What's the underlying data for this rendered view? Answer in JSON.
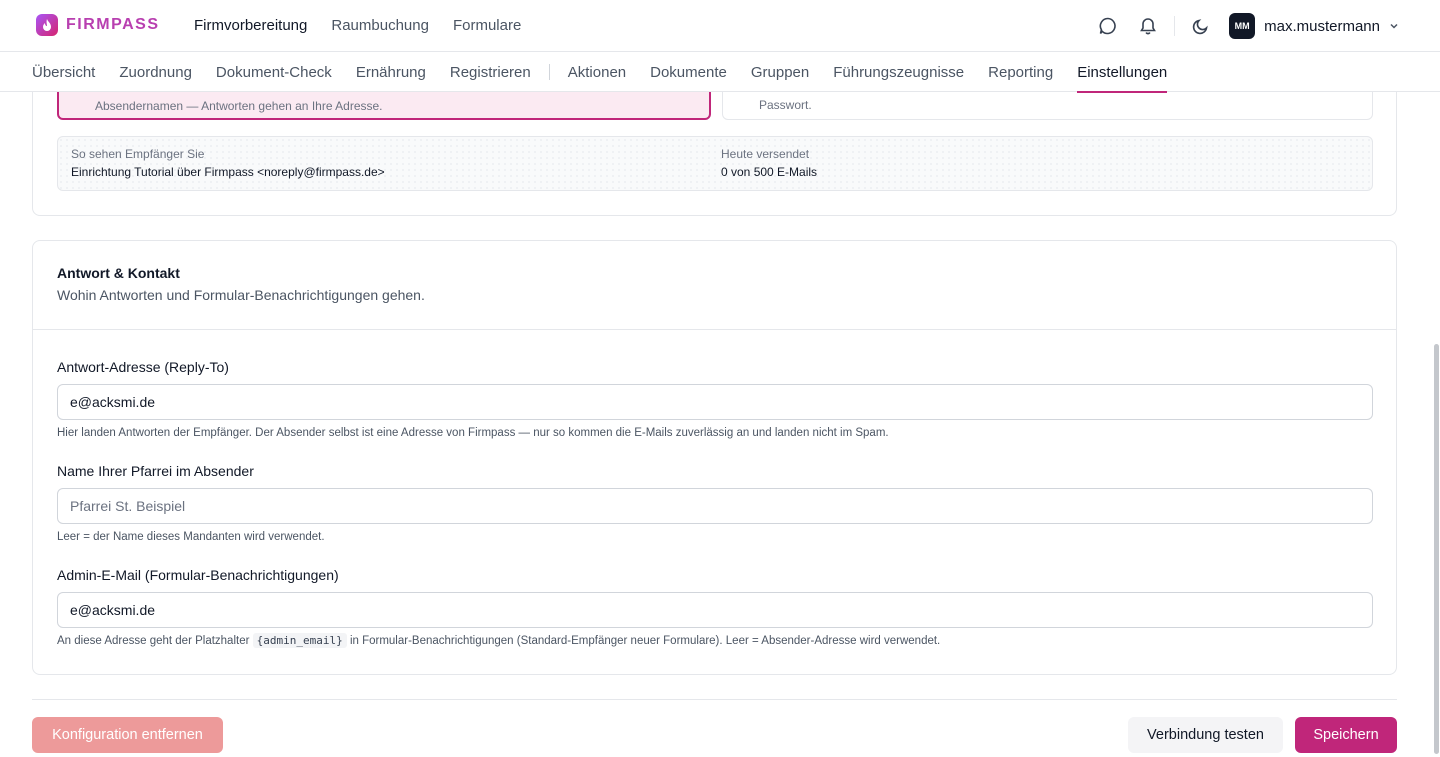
{
  "brand": {
    "name": "FIRMPASS"
  },
  "mainnav": [
    "Firmvorbereitung",
    "Raumbuchung",
    "Formulare"
  ],
  "user": {
    "initials": "MM",
    "name": "max.mustermann"
  },
  "subnav": {
    "group1": [
      "Übersicht",
      "Zuordnung",
      "Dokument-Check",
      "Ernährung",
      "Registrieren"
    ],
    "group2": [
      "Aktionen",
      "Dokumente",
      "Gruppen",
      "Führungszeugnisse",
      "Reporting",
      "Einstellungen"
    ],
    "active": "Einstellungen"
  },
  "sender_card": {
    "option_left_text": "Absendernamen — Antworten gehen an Ihre Adresse.",
    "option_right_text": "Passwort.",
    "preview_label": "So sehen Empfänger Sie",
    "preview_value": "Einrichtung Tutorial über Firmpass <noreply@firmpass.de>",
    "sent_label": "Heute versendet",
    "sent_value": "0 von 500 E-Mails"
  },
  "reply_card": {
    "title": "Antwort & Kontakt",
    "subtitle": "Wohin Antworten und Formular-Benachrichtigungen gehen.",
    "reply_to": {
      "label": "Antwort-Adresse (Reply-To)",
      "value": "e@acksmi.de",
      "help": "Hier landen Antworten der Empfänger. Der Absender selbst ist eine Adresse von Firmpass — nur so kommen die E-Mails zuverlässig an und landen nicht im Spam."
    },
    "sender_name": {
      "label": "Name Ihrer Pfarrei im Absender",
      "value": "",
      "placeholder": "Pfarrei St. Beispiel",
      "help": "Leer = der Name dieses Mandanten wird verwendet."
    },
    "admin_email": {
      "label": "Admin-E-Mail (Formular-Benachrichtigungen)",
      "value": "e@acksmi.de",
      "help_before": "An diese Adresse geht der Platzhalter",
      "help_code": "{admin_email}",
      "help_after": "in Formular-Benachrichtigungen (Standard-Empfänger neuer Formulare). Leer = Absender-Adresse wird verwendet."
    }
  },
  "actions": {
    "remove": "Konfiguration entfernen",
    "test": "Verbindung testen",
    "save": "Speichern"
  },
  "colors": {
    "accent": "#c0267a",
    "remove_button": "#ed9a9a"
  }
}
